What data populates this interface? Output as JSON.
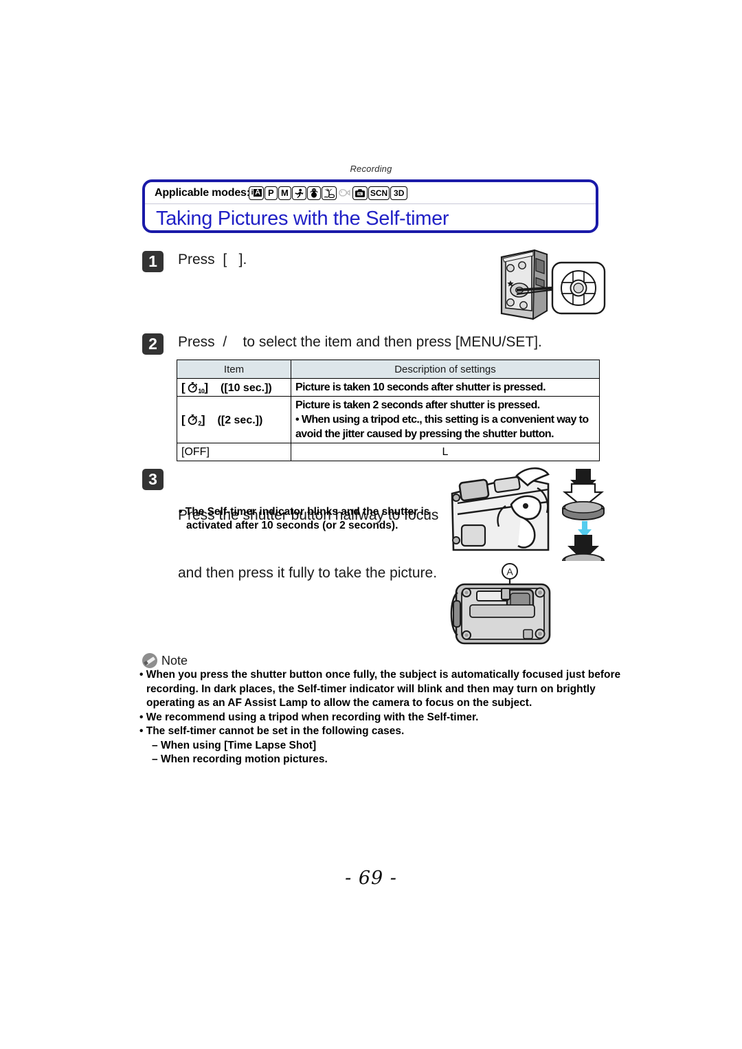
{
  "document": {
    "running_head": "Recording",
    "page_number": "- 69 -"
  },
  "title_box": {
    "applicable_modes_label": "Applicable modes:",
    "mode_icons": [
      {
        "name": "intelligent-auto-mode-icon",
        "label": "iA"
      },
      {
        "name": "program-ae-mode-icon",
        "label": "P"
      },
      {
        "name": "manual-exposure-mode-icon",
        "label": "M"
      },
      {
        "name": "sports-mode-icon",
        "label": "Ἴ3"
      },
      {
        "name": "snow-mode-icon",
        "label": "⛄"
      },
      {
        "name": "beach-surf-mode-icon",
        "label": "Ἵd"
      },
      {
        "name": "underwater-mode-icon",
        "label": "ὁf"
      },
      {
        "name": "creative-control-mode-icon",
        "label": "Ἲ8"
      },
      {
        "name": "scene-mode-icon",
        "label": "SCN"
      },
      {
        "name": "three-d-photo-mode-icon",
        "label": "3D"
      }
    ],
    "title": "Taking Pictures with the Self-timer",
    "title_color": "#2121c6",
    "border_color": "#1a1aa8"
  },
  "steps": [
    {
      "number": "1",
      "text": "Press  [   ]."
    },
    {
      "number": "2",
      "text": "Press  /    to select the item and then press [MENU/SET]."
    },
    {
      "number": "3",
      "line1": "Press the shutter button halfway to focus",
      "line2": "and then press it fully to take the picture.",
      "bullets": [
        "The Self-timer indicator blinks and the shutter is",
        "activated after 10 seconds (or 2 seconds)."
      ]
    }
  ],
  "settings_table": {
    "headers": [
      "Item",
      "Description of settings"
    ],
    "rows": [
      {
        "item_icon": "self-timer-10sec-icon",
        "item_glyph": "⏱",
        "item_sub": "10",
        "item_label": "([10 sec.])",
        "description_lines": [
          "Picture is taken 10 seconds after shutter is pressed."
        ]
      },
      {
        "item_icon": "self-timer-2sec-icon",
        "item_glyph": "⏱",
        "item_sub": "2",
        "item_label": "([2 sec.])",
        "description_lines": [
          "Picture is taken 2 seconds after shutter is pressed.",
          "• When using a tripod etc., this setting is a convenient way to",
          "   avoid the jitter caused by pressing the shutter button."
        ]
      },
      {
        "item_icon": "self-timer-off",
        "item_glyph": "",
        "item_sub": "",
        "item_label": "[OFF]",
        "description_lines": [
          "L"
        ]
      }
    ]
  },
  "note": {
    "label": "Note",
    "icon": "pencil-note-icon",
    "items": [
      {
        "type": "bullet",
        "lines": [
          "When you press the shutter button once fully, the subject is automatically focused just before",
          "recording. In dark places, the Self-timer indicator will blink and then may turn on brightly",
          "operating as an AF Assist Lamp to allow the camera to focus on the subject."
        ]
      },
      {
        "type": "bullet",
        "lines": [
          "We recommend using a tripod when recording with the Self-timer."
        ]
      },
      {
        "type": "bullet",
        "lines": [
          "The self-timer cannot be set in the following cases."
        ]
      },
      {
        "type": "dash",
        "lines": [
          "When using [Time Lapse Shot]"
        ]
      },
      {
        "type": "dash",
        "lines": [
          "When recording motion pictures."
        ]
      }
    ]
  },
  "illustrations": {
    "cursor_button_callout": "camera-rear-cursor-button-illustration",
    "shutter_press_callout": "shutter-button-half-press-full-press-illustration",
    "camera_front_callout_label": "A",
    "camera_front": "camera-front-self-timer-indicator-illustration"
  }
}
